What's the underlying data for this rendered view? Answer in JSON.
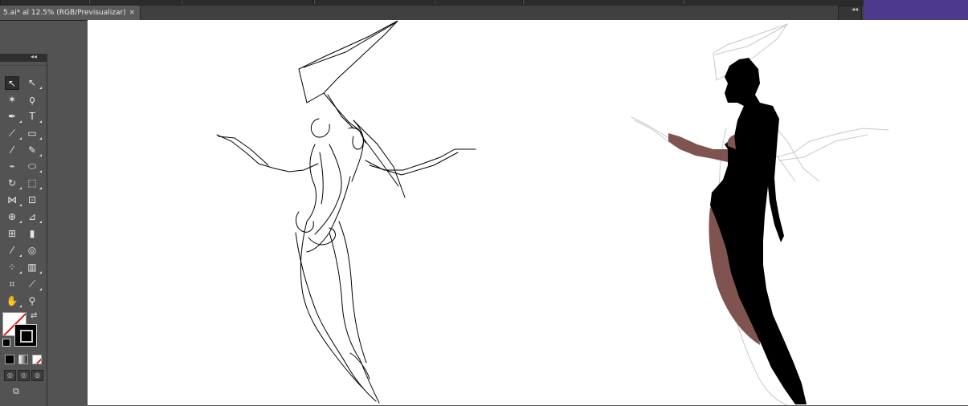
{
  "document": {
    "tab_title": "5.ai* al 12.5% (RGB/Previsualizar)",
    "close_glyph": "×"
  },
  "panel": {
    "collapse_glyph": "◂◂",
    "expand_glyph": "▸▸"
  },
  "tools": [
    {
      "name": "selection-tool",
      "icon": "arrow-icon",
      "glyph": "↖"
    },
    {
      "name": "direct-selection-tool",
      "icon": "hollow-arrow-icon",
      "glyph": "↖"
    },
    {
      "name": "magic-wand-tool",
      "icon": "magic-wand-icon",
      "glyph": "✶"
    },
    {
      "name": "lasso-tool",
      "icon": "lasso-icon",
      "glyph": "ϙ"
    },
    {
      "name": "pen-tool",
      "icon": "pen-nib-icon",
      "glyph": "✒"
    },
    {
      "name": "type-tool",
      "icon": "type-icon",
      "glyph": "T"
    },
    {
      "name": "line-segment-tool",
      "icon": "line-icon",
      "glyph": "⟋"
    },
    {
      "name": "rectangle-tool",
      "icon": "rectangle-icon",
      "glyph": "▭"
    },
    {
      "name": "paintbrush-tool",
      "icon": "brush-icon",
      "glyph": "⁄"
    },
    {
      "name": "pencil-tool",
      "icon": "pencil-icon",
      "glyph": "✎"
    },
    {
      "name": "blob-brush-tool",
      "icon": "blob-brush-icon",
      "glyph": "⌁"
    },
    {
      "name": "eraser-tool",
      "icon": "eraser-icon",
      "glyph": "⬭"
    },
    {
      "name": "rotate-tool",
      "icon": "rotate-icon",
      "glyph": "↻"
    },
    {
      "name": "scale-tool",
      "icon": "scale-icon",
      "glyph": "⬚"
    },
    {
      "name": "width-tool",
      "icon": "width-icon",
      "glyph": "⋈"
    },
    {
      "name": "free-transform-tool",
      "icon": "free-transform-icon",
      "glyph": "⊡"
    },
    {
      "name": "shape-builder-tool",
      "icon": "shape-builder-icon",
      "glyph": "⊕"
    },
    {
      "name": "perspective-grid-tool",
      "icon": "perspective-grid-icon",
      "glyph": "⊿"
    },
    {
      "name": "mesh-tool",
      "icon": "mesh-icon",
      "glyph": "⊞"
    },
    {
      "name": "gradient-tool",
      "icon": "gradient-icon",
      "glyph": "▮"
    },
    {
      "name": "eyedropper-tool",
      "icon": "eyedropper-icon",
      "glyph": "⁄"
    },
    {
      "name": "blend-tool",
      "icon": "blend-icon",
      "glyph": "◎"
    },
    {
      "name": "symbol-sprayer-tool",
      "icon": "symbol-sprayer-icon",
      "glyph": "⁘"
    },
    {
      "name": "column-graph-tool",
      "icon": "column-graph-icon",
      "glyph": "▥"
    },
    {
      "name": "artboard-tool",
      "icon": "artboard-icon",
      "glyph": "⌗"
    },
    {
      "name": "slice-tool",
      "icon": "slice-icon",
      "glyph": "⟋"
    },
    {
      "name": "hand-tool",
      "icon": "hand-icon",
      "glyph": "✋"
    },
    {
      "name": "zoom-tool",
      "icon": "magnifier-icon",
      "glyph": "⚲"
    }
  ],
  "colors": {
    "ui_dark": "#535353",
    "tab_bar": "#3c3c3c",
    "artboard": "#ffffff",
    "accent_purple": "#4d3a8c",
    "figure_black": "#000000",
    "figure_skin": "#7f5350",
    "sketch_gray": "#c8c8c8"
  }
}
